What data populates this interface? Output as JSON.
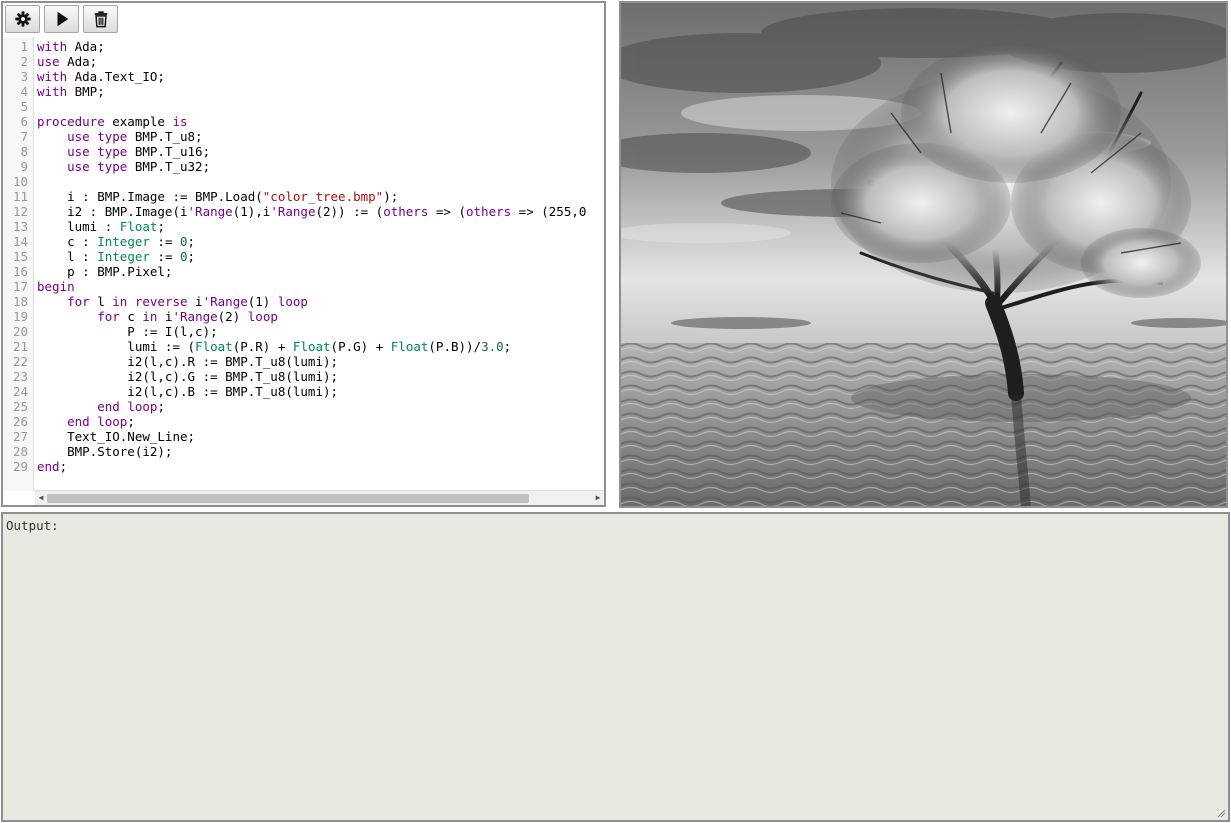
{
  "toolbar": {
    "buttons": [
      {
        "name": "settings",
        "icon": "gear-icon"
      },
      {
        "name": "run",
        "icon": "play-icon"
      },
      {
        "name": "clear",
        "icon": "trash-icon"
      }
    ]
  },
  "editor": {
    "lines": [
      {
        "n": "1",
        "tokens": [
          [
            "kw",
            "with"
          ],
          [
            "pl",
            " Ada;"
          ]
        ]
      },
      {
        "n": "2",
        "tokens": [
          [
            "kw",
            "use"
          ],
          [
            "pl",
            " Ada;"
          ]
        ]
      },
      {
        "n": "3",
        "tokens": [
          [
            "kw",
            "with"
          ],
          [
            "pl",
            " Ada.Text_IO;"
          ]
        ]
      },
      {
        "n": "4",
        "tokens": [
          [
            "kw",
            "with"
          ],
          [
            "pl",
            " BMP;"
          ]
        ]
      },
      {
        "n": "5",
        "tokens": []
      },
      {
        "n": "6",
        "tokens": [
          [
            "kw",
            "procedure"
          ],
          [
            "pl",
            " example "
          ],
          [
            "kw",
            "is"
          ]
        ]
      },
      {
        "n": "7",
        "tokens": [
          [
            "pl",
            "    "
          ],
          [
            "kw",
            "use type"
          ],
          [
            "pl",
            " BMP.T_u8;"
          ]
        ]
      },
      {
        "n": "8",
        "tokens": [
          [
            "pl",
            "    "
          ],
          [
            "kw",
            "use type"
          ],
          [
            "pl",
            " BMP.T_u16;"
          ]
        ]
      },
      {
        "n": "9",
        "tokens": [
          [
            "pl",
            "    "
          ],
          [
            "kw",
            "use type"
          ],
          [
            "pl",
            " BMP.T_u32;"
          ]
        ]
      },
      {
        "n": "10",
        "tokens": []
      },
      {
        "n": "11",
        "tokens": [
          [
            "pl",
            "    i : BMP.Image := BMP.Load("
          ],
          [
            "st",
            "\"color_tree.bmp\""
          ],
          [
            "pl",
            ");"
          ]
        ]
      },
      {
        "n": "12",
        "tokens": [
          [
            "pl",
            "    i2 : BMP.Image(i"
          ],
          [
            "kw",
            "'Range"
          ],
          [
            "pl",
            "(1),i"
          ],
          [
            "kw",
            "'Range"
          ],
          [
            "pl",
            "(2)) := ("
          ],
          [
            "kw",
            "others"
          ],
          [
            "pl",
            " => ("
          ],
          [
            "kw",
            "others"
          ],
          [
            "pl",
            " => (255,0"
          ]
        ]
      },
      {
        "n": "13",
        "tokens": [
          [
            "pl",
            "    lumi : "
          ],
          [
            "ty",
            "Float"
          ],
          [
            "pl",
            ";"
          ]
        ]
      },
      {
        "n": "14",
        "tokens": [
          [
            "pl",
            "    c : "
          ],
          [
            "ty",
            "Integer"
          ],
          [
            "pl",
            " := "
          ],
          [
            "nu",
            "0"
          ],
          [
            "pl",
            ";"
          ]
        ]
      },
      {
        "n": "15",
        "tokens": [
          [
            "pl",
            "    l : "
          ],
          [
            "ty",
            "Integer"
          ],
          [
            "pl",
            " := "
          ],
          [
            "nu",
            "0"
          ],
          [
            "pl",
            ";"
          ]
        ]
      },
      {
        "n": "16",
        "tokens": [
          [
            "pl",
            "    p : BMP.Pixel;"
          ]
        ]
      },
      {
        "n": "17",
        "tokens": [
          [
            "kw",
            "begin"
          ]
        ]
      },
      {
        "n": "18",
        "tokens": [
          [
            "pl",
            "    "
          ],
          [
            "kw",
            "for"
          ],
          [
            "pl",
            " l "
          ],
          [
            "kw",
            "in reverse"
          ],
          [
            "pl",
            " i"
          ],
          [
            "kw",
            "'Range"
          ],
          [
            "pl",
            "(1) "
          ],
          [
            "kw",
            "loop"
          ]
        ]
      },
      {
        "n": "19",
        "tokens": [
          [
            "pl",
            "        "
          ],
          [
            "kw",
            "for"
          ],
          [
            "pl",
            " c "
          ],
          [
            "kw",
            "in"
          ],
          [
            "pl",
            " i"
          ],
          [
            "kw",
            "'Range"
          ],
          [
            "pl",
            "(2) "
          ],
          [
            "kw",
            "loop"
          ]
        ]
      },
      {
        "n": "20",
        "tokens": [
          [
            "pl",
            "            P := I(l,c);"
          ]
        ]
      },
      {
        "n": "21",
        "tokens": [
          [
            "pl",
            "            lumi := ("
          ],
          [
            "ty",
            "Float"
          ],
          [
            "pl",
            "(P.R) + "
          ],
          [
            "ty",
            "Float"
          ],
          [
            "pl",
            "(P.G) + "
          ],
          [
            "ty",
            "Float"
          ],
          [
            "pl",
            "(P.B))/"
          ],
          [
            "nu",
            "3.0"
          ],
          [
            "pl",
            ";"
          ]
        ]
      },
      {
        "n": "22",
        "tokens": [
          [
            "pl",
            "            i2(l,c).R := BMP.T_u8(lumi);"
          ]
        ]
      },
      {
        "n": "23",
        "tokens": [
          [
            "pl",
            "            i2(l,c).G := BMP.T_u8(lumi);"
          ]
        ]
      },
      {
        "n": "24",
        "tokens": [
          [
            "pl",
            "            i2(l,c).B := BMP.T_u8(lumi);"
          ]
        ]
      },
      {
        "n": "25",
        "tokens": [
          [
            "pl",
            "        "
          ],
          [
            "kw",
            "end loop"
          ],
          [
            "pl",
            ";"
          ]
        ]
      },
      {
        "n": "26",
        "tokens": [
          [
            "pl",
            "    "
          ],
          [
            "kw",
            "end loop"
          ],
          [
            "pl",
            ";"
          ]
        ]
      },
      {
        "n": "27",
        "tokens": [
          [
            "pl",
            "    Text_IO.New_Line;"
          ]
        ]
      },
      {
        "n": "28",
        "tokens": [
          [
            "pl",
            "    BMP.Store(i2);"
          ]
        ]
      },
      {
        "n": "29",
        "tokens": [
          [
            "kw",
            "end"
          ],
          [
            "pl",
            ";"
          ]
        ]
      }
    ]
  },
  "output": {
    "label": "Output:"
  },
  "colors": {
    "keyword": "#770088",
    "type": "#008855",
    "string": "#aa1111",
    "number": "#116644",
    "output_bg": "#e9e8e1"
  }
}
